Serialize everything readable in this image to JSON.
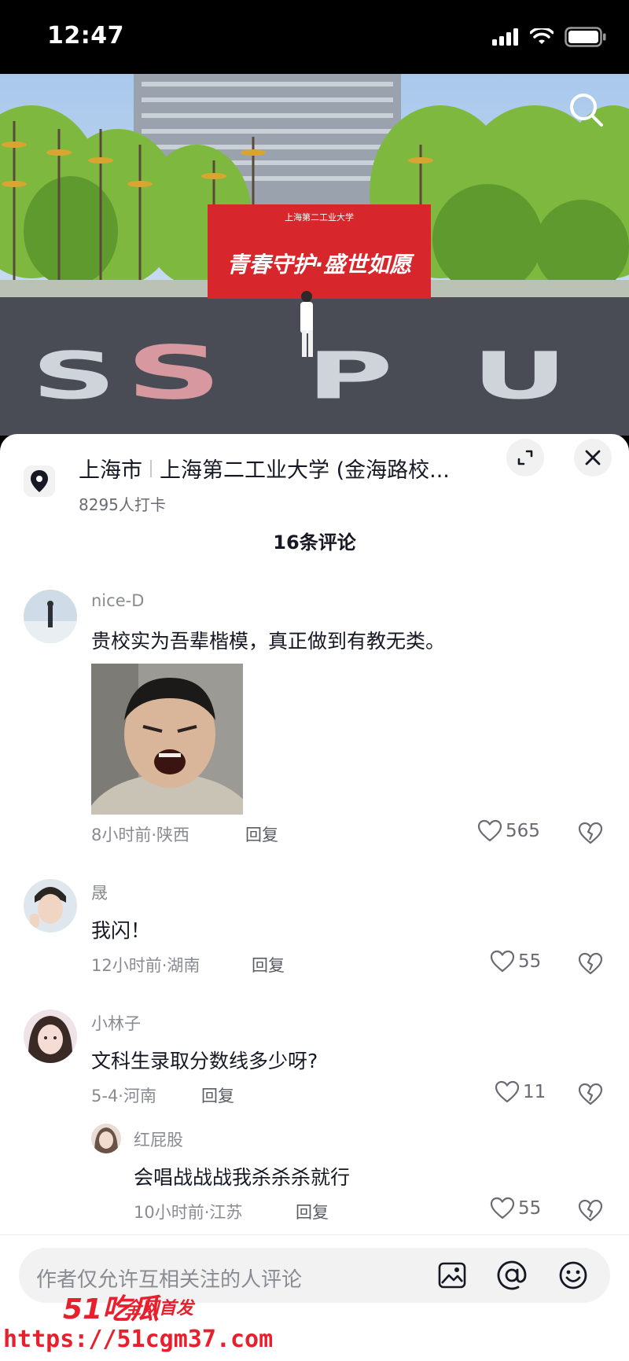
{
  "status_bar": {
    "time": "12:47"
  },
  "video": {
    "banner_title": "青春守护·盛世如愿",
    "banner_header": "上海第二工业大学",
    "ground_letters": "SSPU"
  },
  "location": {
    "city": "上海市",
    "place": "上海第二工业大学 (金海路校...",
    "checkins": "8295人打卡"
  },
  "comments_header": "16条评论",
  "comments": [
    {
      "user": "nice-D",
      "text": "贵校实为吾辈楷模，真正做到有教无类。",
      "time": "8小时前·陕西",
      "reply": "回复",
      "likes": "565"
    },
    {
      "user": "晟",
      "text": "我闪！",
      "time": "12小时前·湖南",
      "reply": "回复",
      "likes": "55"
    },
    {
      "user": "小林子",
      "text": "文科生录取分数线多少呀?",
      "time": "5-4·河南",
      "reply": "回复",
      "likes": "11"
    },
    {
      "user": "红屁股",
      "text": "会唱战战战我杀杀杀就行",
      "time": "10小时前·江苏",
      "reply": "回复",
      "likes": "55"
    }
  ],
  "input": {
    "placeholder": "作者仅允许互相关注的人评论"
  },
  "watermark": {
    "logo": "51吃瓜",
    "slogan": "全网首发",
    "url": "https://51cgm37.com"
  },
  "colors": {
    "accent_red": "#e8202e",
    "banner_red": "#d7262c",
    "muted": "#8a8b91"
  }
}
